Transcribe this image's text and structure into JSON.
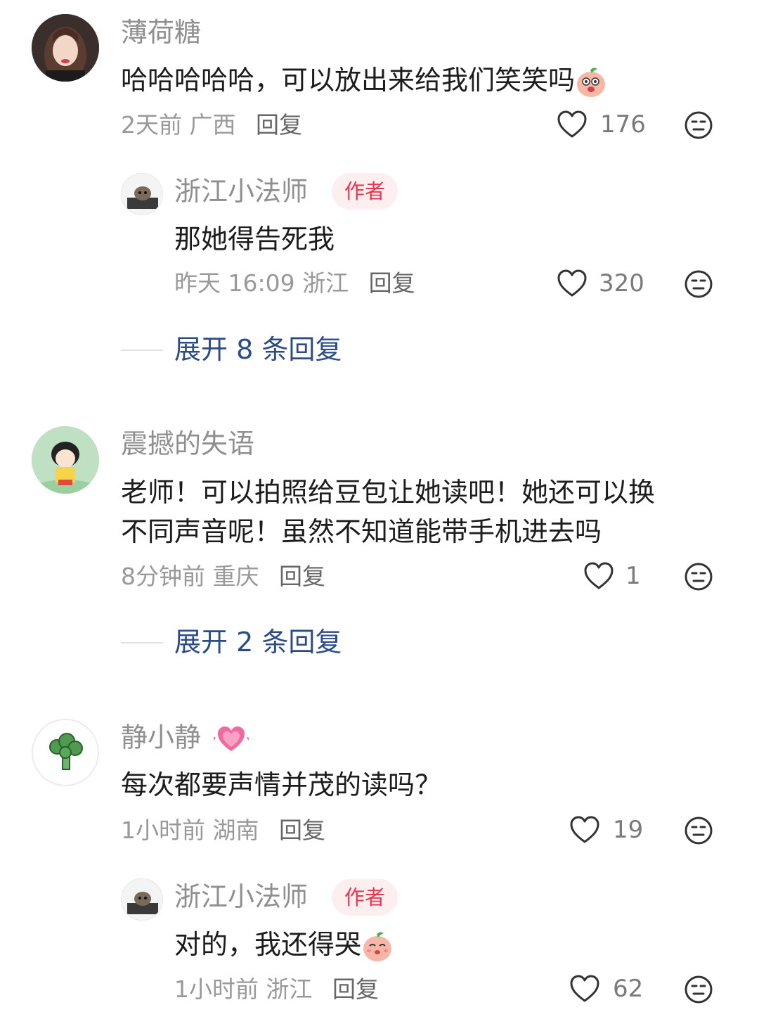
{
  "comments": [
    {
      "username": "薄荷糖",
      "text": "哈哈哈哈哈，可以放出来给我们笑笑吗",
      "time": "2天前",
      "location": "广西",
      "reply_label": "回复",
      "likes": "176"
    },
    {
      "username": "震撼的失语",
      "text_line1": "老师！可以拍照给豆包让她读吧！她还可以换",
      "text_line2": "不同声音呢！虽然不知道能带手机进去吗",
      "time": "8分钟前",
      "location": "重庆",
      "reply_label": "回复",
      "likes": "1"
    },
    {
      "username": "静小静",
      "text": "每次都要声情并茂的读吗？",
      "time": "1小时前",
      "location": "湖南",
      "reply_label": "回复",
      "likes": "19"
    }
  ],
  "replies": [
    {
      "username": "浙江小法师",
      "badge": "作者",
      "text": "那她得告死我",
      "time": "昨天 16:09",
      "location": "浙江",
      "reply_label": "回复",
      "likes": "320"
    },
    {
      "username": "浙江小法师",
      "badge": "作者",
      "text": "对的，我还得哭",
      "time": "1小时前",
      "location": "浙江",
      "reply_label": "回复",
      "likes": "62"
    }
  ],
  "expand": [
    {
      "label": "展开 8 条回复"
    },
    {
      "label": "展开 2 条回复"
    }
  ],
  "icons": {
    "like": "heart-outline-icon",
    "dislike": "meh-face-icon",
    "sticker": "peach-face-sticker",
    "heart_emoji": "sparkling-heart-emoji"
  },
  "colors": {
    "badge_bg": "#fdeef0",
    "badge_text": "#e8364f",
    "expand_text": "#2b4c86"
  }
}
